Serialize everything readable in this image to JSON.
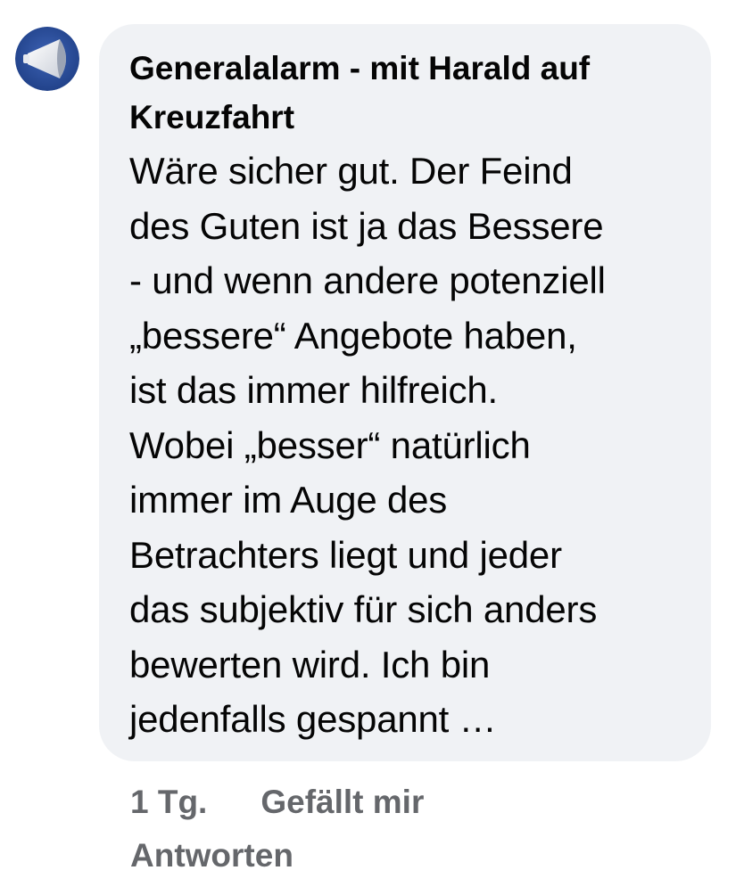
{
  "comment": {
    "author": "Generalalarm - mit Harald auf Kreuzfahrt",
    "text": "Wäre sicher gut. Der Feind\ndes Guten ist ja das Bessere\n- und wenn andere potenziell\n„bessere“ Angebote haben,\nist das immer hilfreich.\nWobei „besser“ natürlich\nimmer im Auge des\nBetrachters liegt und jeder\ndas subjektiv für sich anders\nbewerten wird. Ich bin\njedenfalls gespannt …",
    "timestamp": "1 Tg.",
    "like_label": "Gefällt mir",
    "reply_label": "Antworten"
  },
  "colors": {
    "bubble_bg": "#f0f2f5",
    "text": "#050505",
    "meta_text": "#65676b",
    "avatar_bg": "#2c4f9e"
  },
  "icons": {
    "avatar": "megaphone-logo"
  }
}
